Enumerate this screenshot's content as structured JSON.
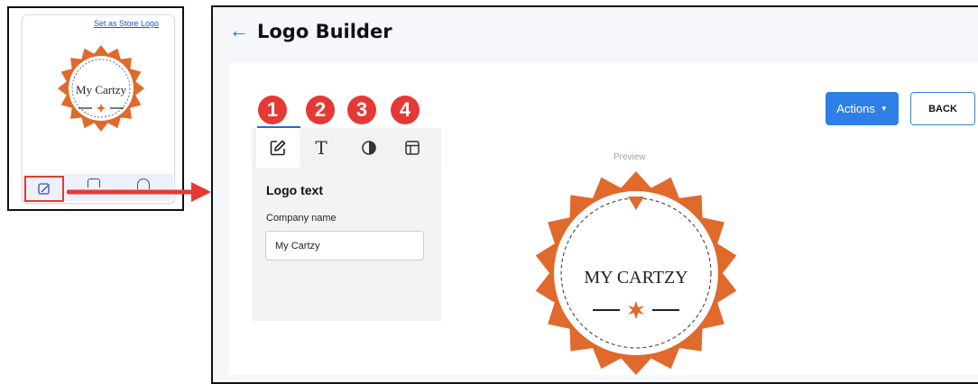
{
  "thumbnail": {
    "set_logo_link": "Set as Store Logo",
    "logo_text": "My Cartzy",
    "icons": [
      "edit-icon",
      "save-icon",
      "info-icon"
    ]
  },
  "header": {
    "back_arrow": "←",
    "title": "Logo Builder"
  },
  "step_badges": [
    "1",
    "2",
    "3",
    "4"
  ],
  "tabs": [
    {
      "icon": "edit-icon",
      "active": true
    },
    {
      "icon": "text-icon",
      "glyph": "T",
      "active": false
    },
    {
      "icon": "contrast-icon",
      "active": false
    },
    {
      "icon": "layout-icon",
      "active": false
    }
  ],
  "panel": {
    "heading": "Logo text",
    "company_label": "Company name",
    "company_value": "My Cartzy"
  },
  "toolbar": {
    "actions_label": "Actions",
    "back_label": "BACK"
  },
  "preview": {
    "label": "Preview",
    "logo_text": "MY CARTZY"
  },
  "colors": {
    "accent": "#2f7fe8",
    "badge": "#e53935",
    "logo_orange": "#e0692c"
  }
}
